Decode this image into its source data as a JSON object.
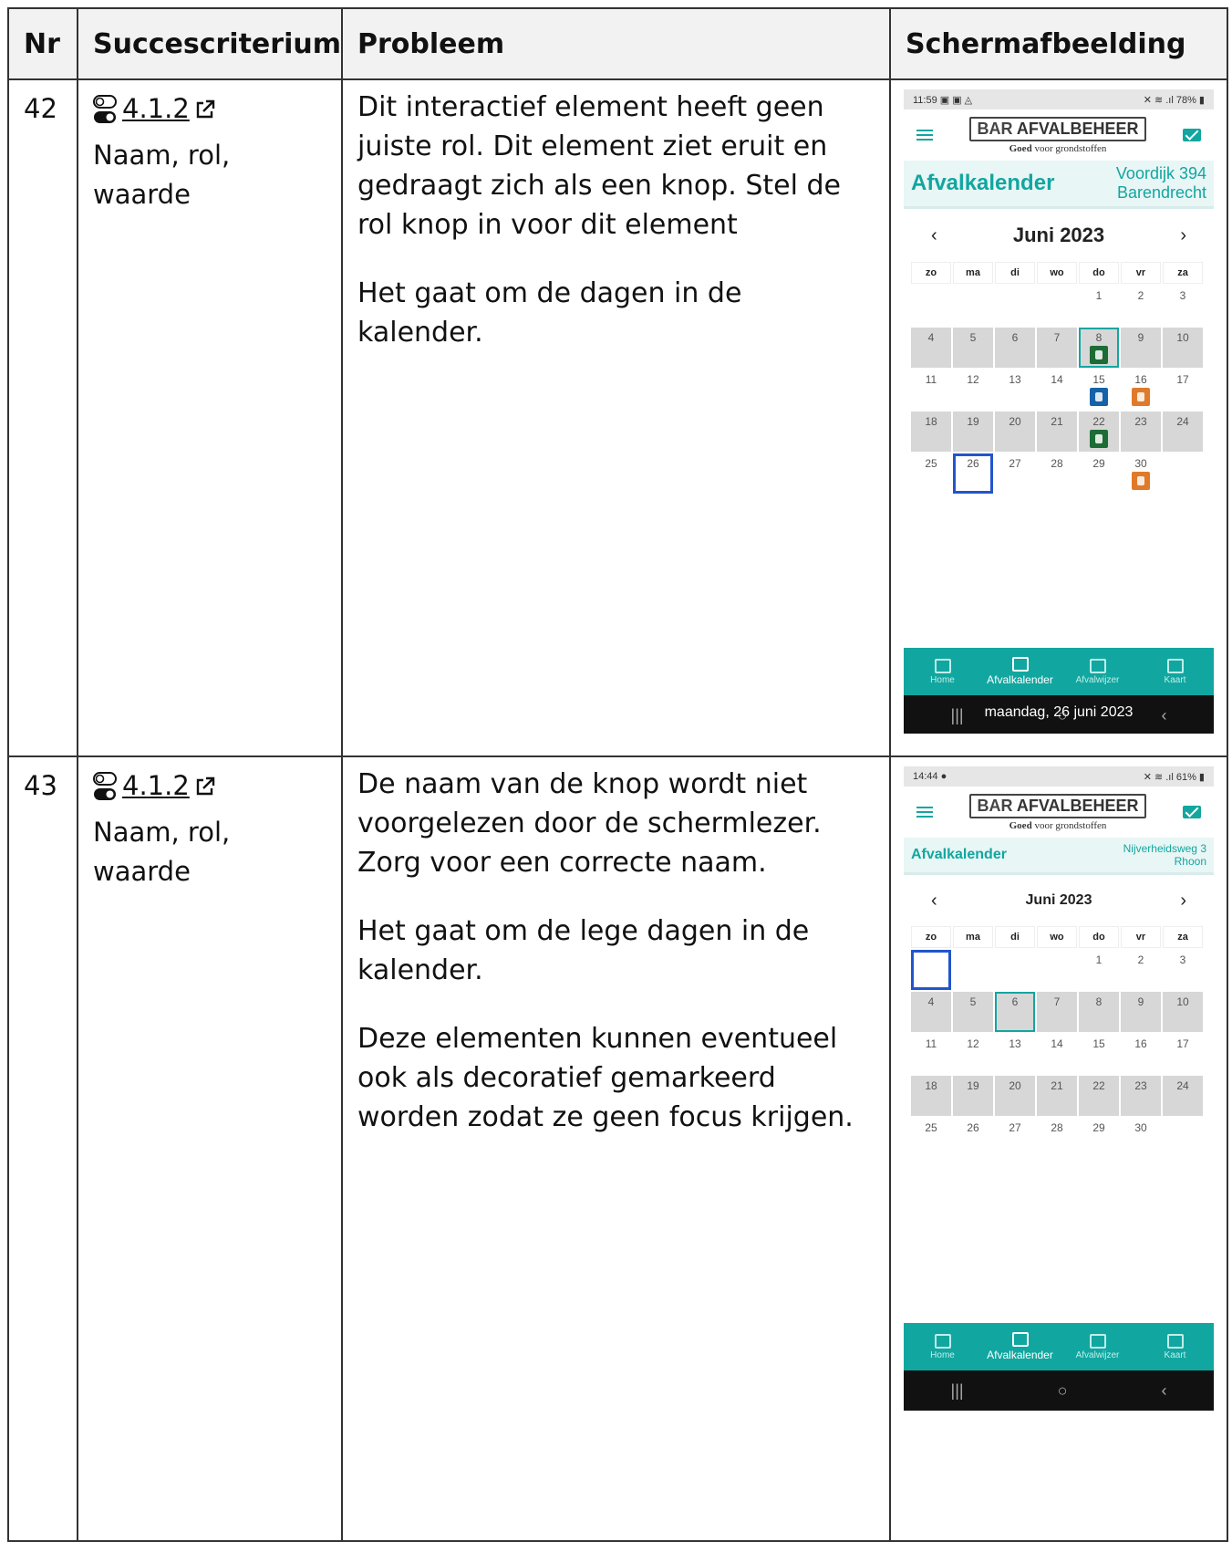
{
  "table": {
    "headers": {
      "nr": "Nr",
      "criterion": "Succescriterium",
      "problem": "Probleem",
      "screenshot": "Schermafbeelding"
    },
    "rows": [
      {
        "nr": "42",
        "criterion_code": "4.1.2",
        "criterion_name": "Naam, rol, waarde",
        "problem_paragraphs": [
          "Dit interactief element heeft geen juiste rol. Dit element ziet eruit en gedraagt zich als een knop. Stel de rol knop in voor dit element",
          "Het gaat om de dagen in de kalender."
        ],
        "phone": {
          "status_time": "11:59 ▣ ▣ ◬",
          "status_right": "✕ ≋ .ıl 78% ▮",
          "logo_bar": "BAR",
          "logo_name": "AFVALBEHEER",
          "logo_tag_bold": "Goed",
          "logo_tag_rest": "voor grondstoffen",
          "title": "Afvalkalender",
          "address_line1": "Voordijk 394",
          "address_line2": "Barendrecht",
          "month": "Juni 2023",
          "prev": "‹",
          "next": "›",
          "weekdays": [
            "zo",
            "ma",
            "di",
            "wo",
            "do",
            "vr",
            "za"
          ],
          "nav": [
            "Home",
            "Afvalkalender",
            "Afvalwijzer",
            "Kaart"
          ],
          "toast": "maandag, 26 juni 2023",
          "sys_buttons": [
            "|||",
            "○",
            "‹"
          ]
        }
      },
      {
        "nr": "43",
        "criterion_code": "4.1.2",
        "criterion_name": "Naam, rol, waarde",
        "problem_paragraphs": [
          "De naam van de knop wordt niet voorgelezen door de schermlezer. Zorg voor een correcte naam.",
          "Het gaat om de lege dagen in de kalender.",
          "Deze elementen kunnen eventueel ook als decoratief gemarkeerd worden zodat ze geen focus krijgen."
        ],
        "phone": {
          "status_time": "14:44 ●",
          "status_right": "✕ ≋ .ıl 61% ▮",
          "logo_bar": "BAR",
          "logo_name": "AFVALBEHEER",
          "logo_tag_bold": "Goed",
          "logo_tag_rest": "voor grondstoffen",
          "title": "Afvalkalender",
          "address_line1": "Nijverheidsweg 3",
          "address_line2": "Rhoon",
          "month": "Juni 2023",
          "prev": "‹",
          "next": "›",
          "weekdays": [
            "zo",
            "ma",
            "di",
            "wo",
            "do",
            "vr",
            "za"
          ],
          "nav": [
            "Home",
            "Afvalkalender",
            "Afvalwijzer",
            "Kaart"
          ],
          "sys_buttons": [
            "|||",
            "○",
            "‹"
          ]
        }
      }
    ]
  },
  "calendar_days": [
    "",
    "",
    "",
    "",
    "1",
    "2",
    "3",
    "4",
    "5",
    "6",
    "7",
    "8",
    "9",
    "10",
    "11",
    "12",
    "13",
    "14",
    "15",
    "16",
    "17",
    "18",
    "19",
    "20",
    "21",
    "22",
    "23",
    "24",
    "25",
    "26",
    "27",
    "28",
    "29",
    "30",
    ""
  ],
  "colors": {
    "teal": "#12a6a0",
    "focus_blue": "#2255cc",
    "pickup_green": "#1d6b35",
    "pickup_blue": "#1562a8",
    "pickup_orange": "#e07a2a"
  }
}
